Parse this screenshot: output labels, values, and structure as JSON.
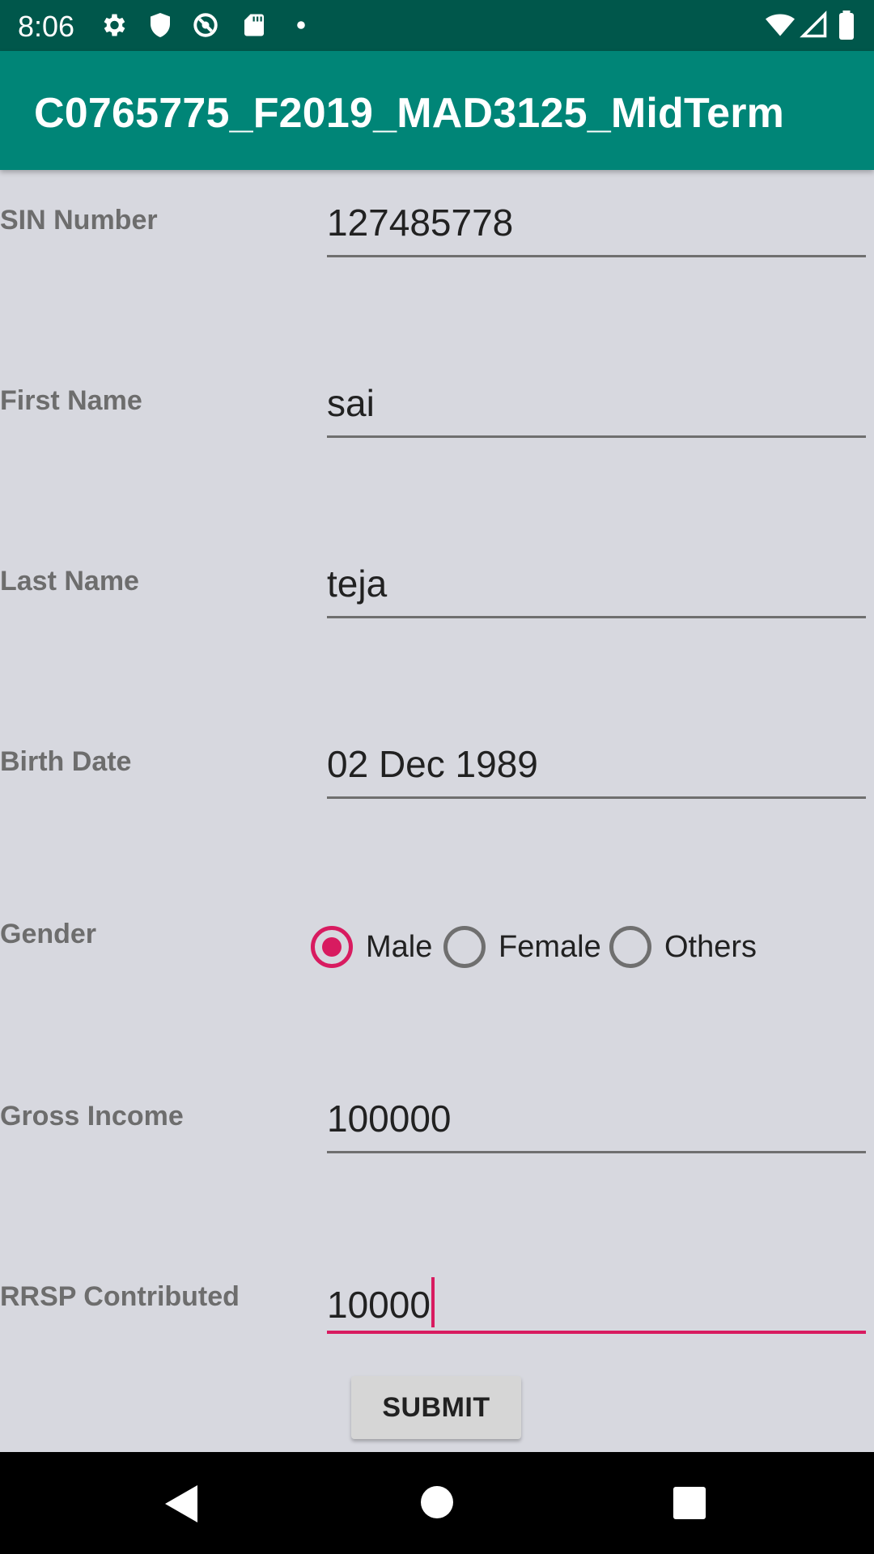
{
  "status_bar": {
    "time": "8:06",
    "icons": [
      "gear-icon",
      "shield-icon",
      "data-saver-icon",
      "sd-card-icon",
      "dot-icon",
      "wifi-icon",
      "signal-icon",
      "battery-icon"
    ]
  },
  "app_bar": {
    "title": "C0765775_F2019_MAD3125_MidTerm",
    "color": "#008577"
  },
  "form": {
    "sin": {
      "label": "SIN Number",
      "value": "127485778"
    },
    "first_name": {
      "label": "First Name",
      "value": "sai"
    },
    "last_name": {
      "label": "Last Name",
      "value": "teja"
    },
    "birth_date": {
      "label": "Birth Date",
      "value": "02 Dec 1989"
    },
    "gender": {
      "label": "Gender",
      "options": [
        "Male",
        "Female",
        "Others"
      ],
      "selected": "Male"
    },
    "gross_income": {
      "label": "Gross Income",
      "value": "100000"
    },
    "rrsp": {
      "label": "RRSP Contributed",
      "value": "10000"
    },
    "submit_label": "SUBMIT"
  },
  "accent_color": "#d81b60",
  "nav_bar": {
    "icons": [
      "back-icon",
      "home-icon",
      "recents-icon"
    ]
  }
}
